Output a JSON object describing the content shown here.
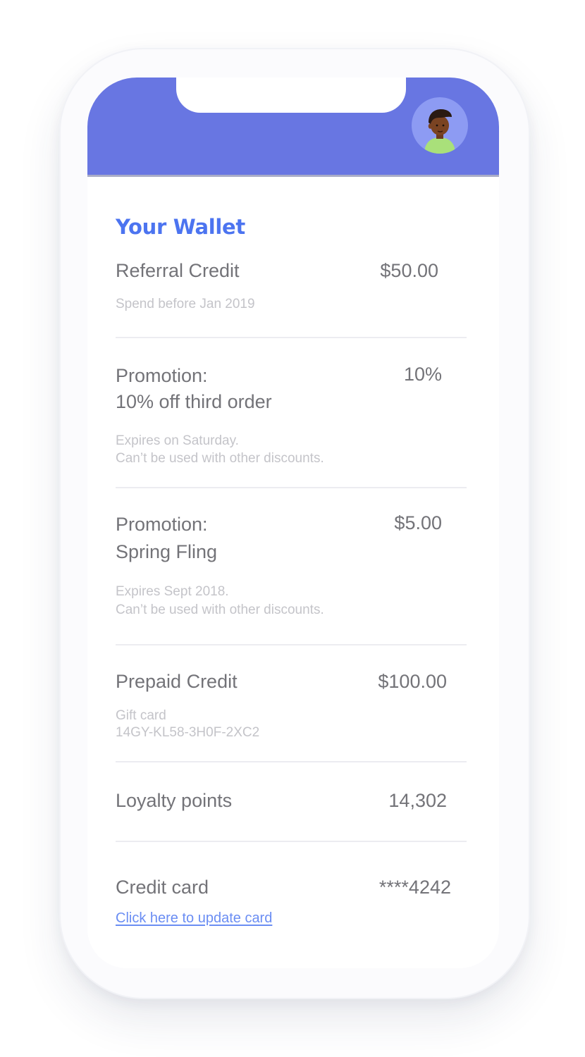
{
  "wallet": {
    "title": "Your Wallet"
  },
  "items": [
    {
      "label": "Referral Credit",
      "value": "$50.00",
      "sub": [
        "Spend before Jan 2019"
      ]
    },
    {
      "label_lines": [
        "Promotion:",
        "10% off third order"
      ],
      "value": "10%",
      "sub": [
        "Expires on Saturday.",
        "Can’t be used with other discounts."
      ]
    },
    {
      "label_lines": [
        "Promotion:",
        "Spring Fling"
      ],
      "value": "$5.00",
      "sub": [
        "Expires Sept 2018.",
        "Can’t be used with other discounts."
      ]
    },
    {
      "label": "Prepaid Credit",
      "value": "$100.00",
      "sub": [
        "Gift card",
        "14GY-KL58-3H0F-2XC2"
      ]
    },
    {
      "label": "Loyalty points",
      "value": "14,302"
    },
    {
      "label": "Credit card",
      "value": "****4242",
      "link": "Click here to update card"
    }
  ],
  "colors": {
    "header": "#6876e2",
    "title": "#4c74f0",
    "link": "#6a8df3"
  },
  "icons": {
    "avatar": "user-avatar-icon"
  }
}
